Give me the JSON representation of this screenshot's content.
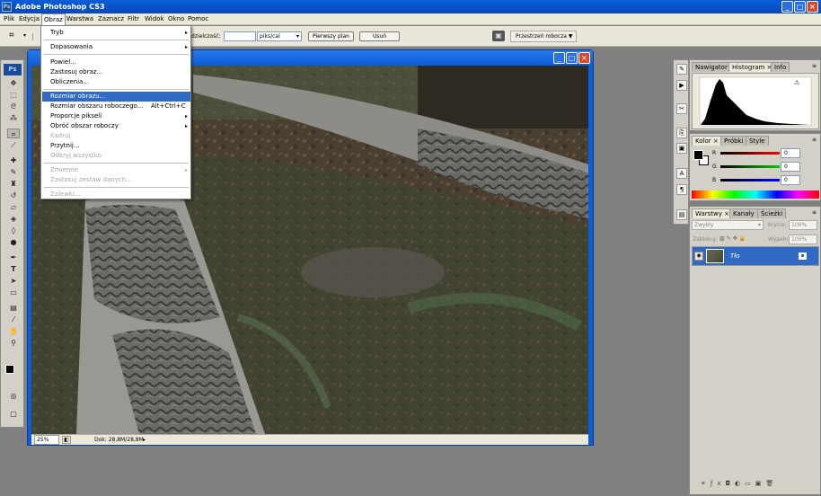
{
  "app": {
    "title": "Adobe Photoshop CS3",
    "logo_text": "Ps",
    "window_buttons": [
      "_",
      "□",
      "×"
    ],
    "accent_color": "#0a5ed8",
    "selection_color": "#316ac5"
  },
  "menubar": {
    "items": [
      "Plik",
      "Edycja",
      "Obraz",
      "Warstwa",
      "Zaznacz",
      "Filtr",
      "Widok",
      "Okno",
      "Pomoc"
    ],
    "active": "Obraz"
  },
  "options_bar": {
    "field_label": "dzielczość:",
    "resolution_value": "",
    "unit": "piks/cal",
    "front_image_button": "Pierwszy plan",
    "clear_button": "Usuń",
    "workspace_button": "Przestrzeń robocza"
  },
  "image_menu": {
    "items": [
      {
        "label": "Tryb",
        "shortcut": "",
        "submenu": true,
        "enabled": true
      },
      {
        "label": "Dopasowania",
        "shortcut": "",
        "submenu": true,
        "enabled": true
      },
      {
        "label": "Powiel...",
        "shortcut": "",
        "submenu": false,
        "enabled": true
      },
      {
        "label": "Zastosuj obraz...",
        "shortcut": "",
        "submenu": false,
        "enabled": true
      },
      {
        "label": "Obliczenia...",
        "shortcut": "",
        "submenu": false,
        "enabled": true
      },
      {
        "label": "Rozmiar obrazu...",
        "shortcut": "",
        "submenu": false,
        "enabled": true,
        "highlighted": true
      },
      {
        "label": "Rozmiar obszaru roboczego...",
        "shortcut": "Alt+Ctrl+C",
        "submenu": false,
        "enabled": true
      },
      {
        "label": "Proporcje pikseli",
        "shortcut": "",
        "submenu": true,
        "enabled": true
      },
      {
        "label": "Obróć obszar roboczy",
        "shortcut": "",
        "submenu": true,
        "enabled": true
      },
      {
        "label": "Kadruj",
        "shortcut": "",
        "submenu": false,
        "enabled": false
      },
      {
        "label": "Przytnij...",
        "shortcut": "",
        "submenu": false,
        "enabled": true
      },
      {
        "label": "Odkryj wszystko",
        "shortcut": "",
        "submenu": false,
        "enabled": false
      },
      {
        "label": "Zmienne",
        "shortcut": "",
        "submenu": true,
        "enabled": false
      },
      {
        "label": "Zastosuj zestaw danych...",
        "shortcut": "",
        "submenu": false,
        "enabled": false
      },
      {
        "label": "Zalewki...",
        "shortcut": "",
        "submenu": false,
        "enabled": false
      }
    ]
  },
  "document": {
    "zoom": "25%",
    "doc_info": "Dok: 28,8M/28,8M"
  },
  "panels": {
    "navigator_tabs": [
      "Nawigator",
      "Histogram",
      "Info"
    ],
    "color_tabs": [
      "Kolor",
      "Próbki",
      "Style"
    ],
    "color_channels": [
      {
        "label": "R",
        "value": "0",
        "color": "#c00000"
      },
      {
        "label": "G",
        "value": "0",
        "color": "#00a000"
      },
      {
        "label": "B",
        "value": "0",
        "color": "#0000c0"
      }
    ],
    "layers_tabs": [
      "Warstwy",
      "Kanały",
      "Ścieżki"
    ],
    "blend_mode": "Zwykły",
    "opacity_label": "Krycie:",
    "opacity_value": "100%",
    "lock_label": "Zablokuj:",
    "fill_label": "Wypełnij:",
    "fill_value": "100%",
    "layer_name": "Tło"
  }
}
